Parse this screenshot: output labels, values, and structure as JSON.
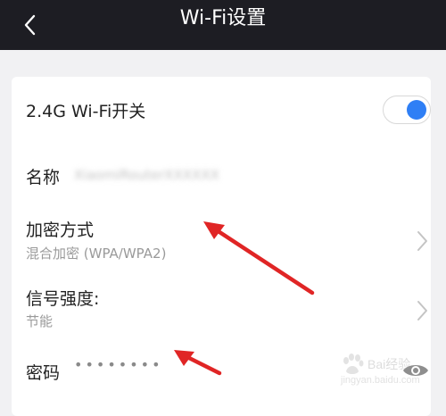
{
  "header": {
    "title": "Wi-Fi设置",
    "back_icon": "chevron-left-icon"
  },
  "settings": {
    "wifi_24g": {
      "label": "2.4G Wi-Fi开关",
      "toggle_on": true,
      "accent_color": "#2f7ff5"
    },
    "name": {
      "label": "名称",
      "value": "XiaomiRouterXXXXXX"
    },
    "encryption": {
      "label": "加密方式",
      "value": "混合加密 (WPA/WPA2)"
    },
    "signal": {
      "label": "信号强度:",
      "value": "节能"
    },
    "password": {
      "label": "密码",
      "masked_value": "••••••••",
      "reveal_icon": "eye-icon"
    }
  },
  "watermark": {
    "brand": "Bai",
    "brand_suffix": "经验",
    "url": "jingyan.baidu.com"
  },
  "colors": {
    "header_bg": "#1d1d23",
    "page_bg": "#f1f1f3",
    "arrow": "#e02525"
  }
}
